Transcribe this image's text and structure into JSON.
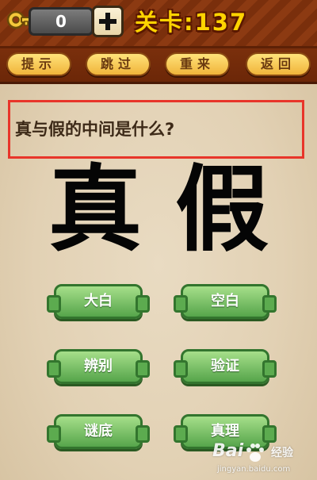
{
  "topbar": {
    "key_icon": "key-icon",
    "coins": "0",
    "plus_icon": "plus-icon",
    "level_label": "关卡:137"
  },
  "toolbar": {
    "hint_label": "提示",
    "skip_label": "跳过",
    "restart_label": "重来",
    "back_label": "返回"
  },
  "question": {
    "text": "真与假的中间是什么?",
    "highlight_color": "#e8352a"
  },
  "characters": [
    "真",
    "假"
  ],
  "answers": [
    {
      "label": "大白"
    },
    {
      "label": "空白"
    },
    {
      "label": "辨别"
    },
    {
      "label": "验证"
    },
    {
      "label": "谜底"
    },
    {
      "label": "真理"
    }
  ],
  "colors": {
    "topbar": "#8c3a12",
    "level_text": "#ffd400",
    "tool_button": "#f0b43a",
    "answer_button": "#56a54b",
    "background": "#e2d1b4"
  },
  "watermark": {
    "logo": "Bai",
    "logo_icon": "paw-icon",
    "text": "经验",
    "url": "jingyan.baidu.com"
  }
}
